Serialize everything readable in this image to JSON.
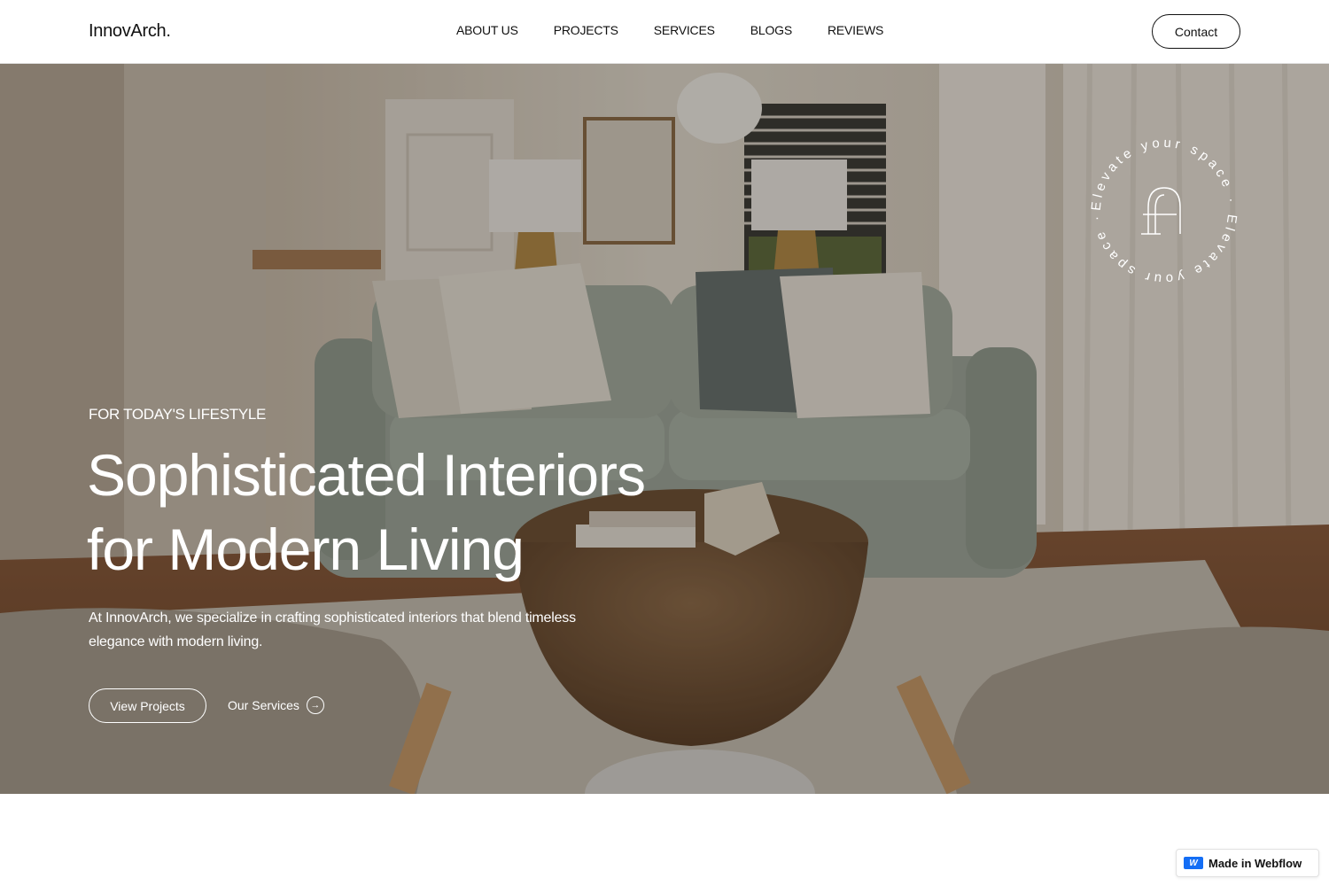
{
  "header": {
    "logo": "InnovArch.",
    "nav": [
      "ABOUT US",
      "PROJECTS",
      "SERVICES",
      "BLOGS",
      "REVIEWS"
    ],
    "contact_label": "Contact"
  },
  "hero": {
    "eyebrow": "FOR TODAY'S LIFESTYLE",
    "headline_line1": "Sophisticated Interiors",
    "headline_line2": "for Modern Living",
    "description": "At InnovArch, we specialize in crafting sophisticated interiors that blend timeless elegance with modern living.",
    "primary_button": "View Projects",
    "secondary_link": "Our Services",
    "secondary_icon": "arrow-right-circle-icon",
    "badge_text": "Elevate your space · Elevate your space ·"
  },
  "webflow_badge": {
    "label": "Made in Webflow"
  },
  "colors": {
    "accent": "#146ef5",
    "text": "#111111",
    "hero_text": "#ffffff"
  }
}
